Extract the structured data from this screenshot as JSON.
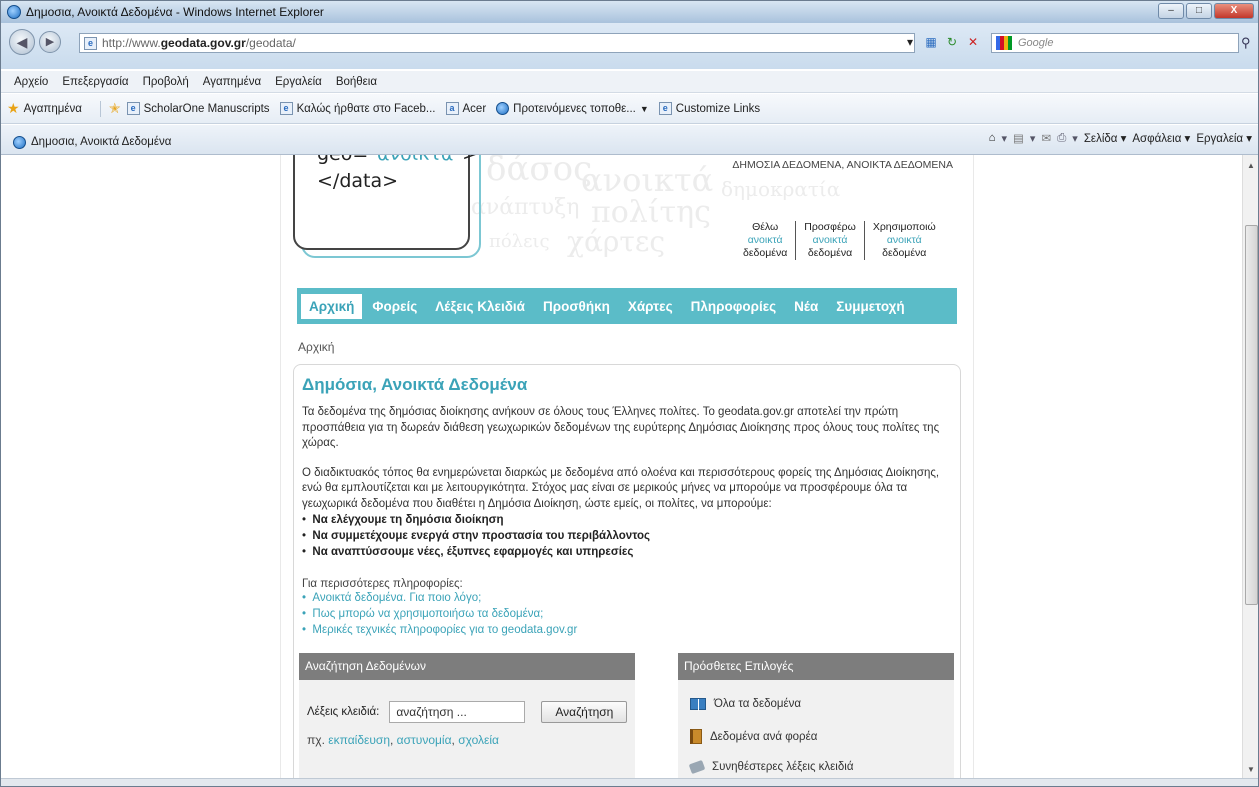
{
  "window": {
    "title": "Δημοσια, Ανοικτά Δεδομένα - Windows Internet Explorer",
    "controls": [
      "minimize",
      "restore",
      "close"
    ]
  },
  "address": {
    "url_prefix": "http://www.",
    "url_domain": "geodata.gov.gr",
    "url_path": "/geodata/",
    "search_placeholder": "Google"
  },
  "menu": [
    "Αρχείο",
    "Επεξεργασία",
    "Προβολή",
    "Αγαπημένα",
    "Εργαλεία",
    "Βοήθεια"
  ],
  "favorites": {
    "label": "Αγαπημένα",
    "links": [
      "ScholarOne Manuscripts",
      "Καλώς ήρθατε στο Faceb...",
      "Acer",
      "Προτεινόμενες τοποθε...",
      "Customize Links"
    ]
  },
  "tab": {
    "title": "Δημοσια, Ανοικτά Δεδομένα"
  },
  "commandbar": {
    "page": "Σελίδα",
    "safety": "Ασφάλεια",
    "tools": "Εργαλεία"
  },
  "site": {
    "header_tag": "ΔΗΜΟΣΙΑ ΔΕΔΟΜΕΝΑ, ΑΝΟΙΚΤΑ ΔΕΔΟΜΕΝΑ",
    "logo_line1_pre": "geo=\"",
    "logo_line1_word": "ανοικτά",
    "logo_line1_post": "\">",
    "logo_line2": "</data>",
    "bg_words": [
      "δάσος",
      "ανοικτά",
      "δημοκρατία",
      "ανάπτυξη",
      "πολίτης",
      "πόλεις",
      "χάρτες"
    ],
    "quicklinks": [
      {
        "a": "Θέλω",
        "b": "ανοικτά",
        "c": "δεδομένα"
      },
      {
        "a": "Προσφέρω",
        "b": "ανοικτά",
        "c": "δεδομένα"
      },
      {
        "a": "Χρησιμοποιώ",
        "b": "ανοικτά",
        "c": "δεδομένα"
      }
    ],
    "nav": [
      "Αρχική",
      "Φορείς",
      "Λέξεις Κλειδιά",
      "Προσθήκη",
      "Χάρτες",
      "Πληροφορίες",
      "Νέα",
      "Συμμετοχή"
    ],
    "breadcrumb": "Αρχική",
    "heading": "Δημόσια, Ανοικτά Δεδομένα",
    "para1": "Τα δεδομένα της δημόσιας διοίκησης ανήκουν σε όλους τους Έλληνες πολίτες. Το geodata.gov.gr αποτελεί την πρώτη προσπάθεια για τη δωρεάν διάθεση γεωχωρικών δεδομένων της ευρύτερης Δημόσιας Διοίκησης προς όλους τους πολίτες της χώρας.",
    "para2": "Ο διαδικτυακός τόπος θα ενημερώνεται διαρκώς με δεδομένα από ολοένα και περισσότερους φορείς της Δημόσιας Διοίκησης, ενώ θα εμπλουτίζεται και με λειτουργικότητα. Στόχος μας είναι σε μερικούς μήνες να μπορούμε να προσφέρουμε όλα τα γεωχωρικά δεδομένα που διαθέτει η Δημόσια Διοίκηση, ώστε εμείς, οι πολίτες, να μπορούμε:",
    "bullets": [
      "Να ελέγχουμε τη δημόσια διοίκηση",
      "Να συμμετέχουμε ενεργά στην προστασία του περιβάλλοντος",
      "Να αναπτύσσουμε νέες, έξυπνες εφαρμογές και υπηρεσίες"
    ],
    "more_heading": "Για περισσότερες πληροφορίες:",
    "more_links": [
      "Ανοικτά δεδομένα. Για ποιο λόγο;",
      "Πως μπορώ να χρησιμοποιήσω τα δεδομένα;",
      "Μερικές τεχνικές πληροφορίες για το geodata.gov.gr"
    ],
    "search_panel": {
      "title": "Αναζήτηση Δεδομένων",
      "label": "Λέξεις κλειδιά:",
      "value": "αναζήτηση ...",
      "button": "Αναζήτηση",
      "examples_prefix": "πχ.",
      "examples": [
        "εκπαίδευση",
        "αστυνομία",
        "σχολεία"
      ]
    },
    "options_panel": {
      "title": "Πρόσθετες Επιλογές",
      "items": [
        "Όλα τα δεδομένα",
        "Δεδομένα ανά φορέα",
        "Συνηθέστερες λέξεις κλειδιά"
      ]
    }
  }
}
